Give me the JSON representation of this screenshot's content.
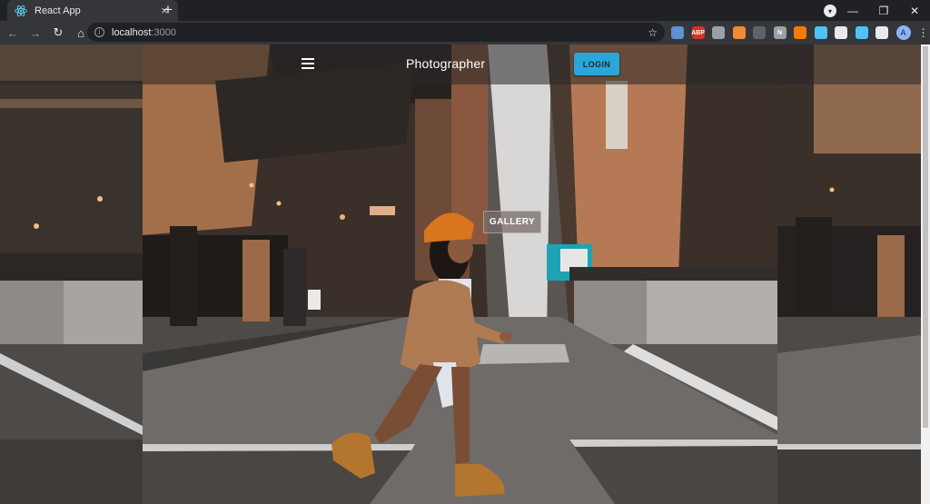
{
  "browser": {
    "tab_title": "React App",
    "tab_close": "×",
    "new_tab": "+",
    "url_host": "localhost",
    "url_port": ":3000",
    "window_buttons": {
      "minimize": "—",
      "restore": "❐",
      "close": "✕"
    },
    "profile_initial": "A",
    "extensions": [
      {
        "name": "globe-extension-icon",
        "label": "",
        "color": "#5f8fd6"
      },
      {
        "name": "adblock-extension-icon",
        "label": "ABP",
        "color": "#d93025"
      },
      {
        "name": "stopwatch-extension-icon",
        "label": "",
        "color": "#9aa0a6"
      },
      {
        "name": "arrow-extension-icon",
        "label": "",
        "color": "#f28b30"
      },
      {
        "name": "puzzle-robot-extension-icon",
        "label": "",
        "color": "#5f6368"
      },
      {
        "name": "n-extension-icon",
        "label": "N",
        "color": "#9aa0a6"
      },
      {
        "name": "picture-extension-icon",
        "label": "",
        "color": "#f57c00"
      },
      {
        "name": "camera-extension-icon",
        "label": "",
        "color": "#4fc3f7"
      },
      {
        "name": "flag-extension-icon",
        "label": "",
        "color": "#e8eaed"
      },
      {
        "name": "link-extension-icon",
        "label": "",
        "color": "#4fc3f7"
      },
      {
        "name": "puzzle-extension-icon",
        "label": "",
        "color": "#e8eaed"
      }
    ]
  },
  "page": {
    "brand": "Photographer",
    "login_label": "LOGIN",
    "gallery_label": "GALLERY",
    "accent_color": "#2aa7d8"
  }
}
